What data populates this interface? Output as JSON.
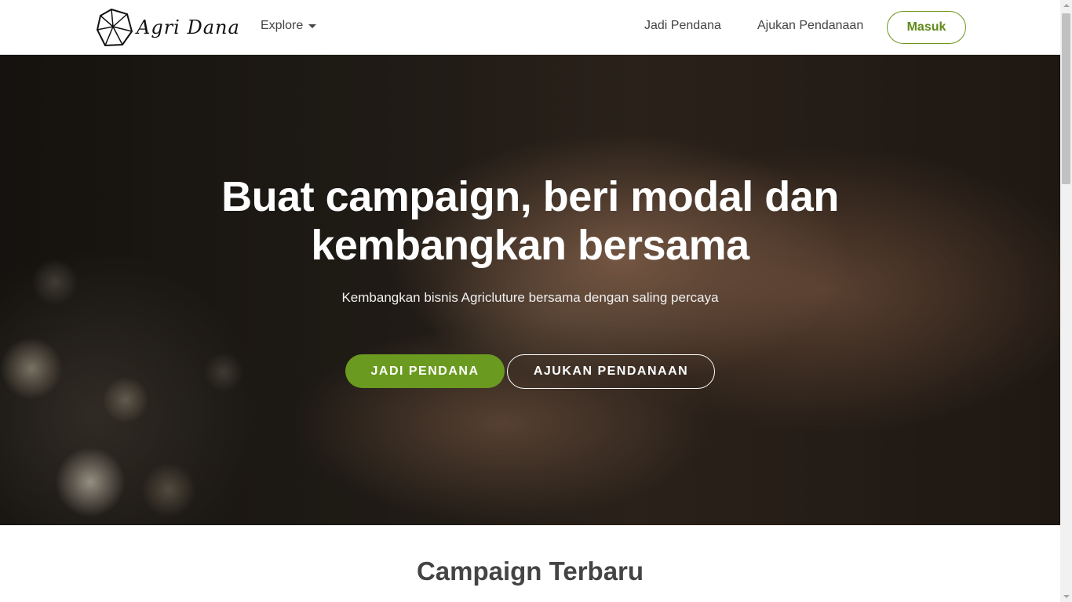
{
  "brand": {
    "name": "Agri Dana",
    "logo_icon": "polyhedron-logo-icon"
  },
  "nav": {
    "explore_label": "Explore",
    "links": [
      "Jadi Pendana",
      "Ajukan Pendanaan"
    ],
    "login_label": "Masuk"
  },
  "hero": {
    "title_line1": "Buat campaign, beri modal dan",
    "title_line2": "kembangkan bersama",
    "subtitle": "Kembangkan bisnis Agricluture bersama dengan saling percaya",
    "primary_button": "JADI PENDANA",
    "secondary_button": "AJUKAN PENDANAAN"
  },
  "section": {
    "title": "Campaign Terbaru"
  },
  "colors": {
    "accent": "#6a9a1f",
    "accent_text": "#5f8a1a"
  }
}
